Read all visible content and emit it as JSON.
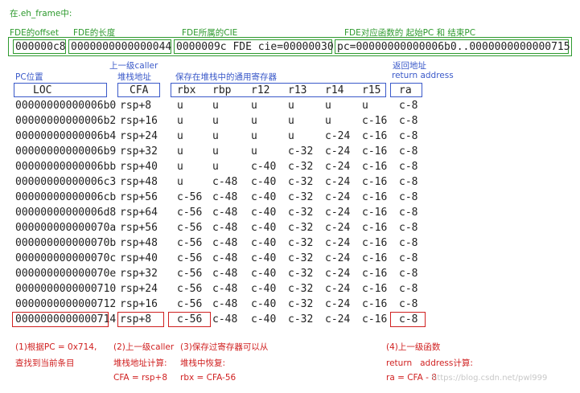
{
  "top": {
    "title": "在.eh_frame中:",
    "fde_labels": [
      "FDE的offset",
      "FDE的长度",
      "FDE所属的CIE",
      "FDE对应函数的 起始PC 和 结束PC"
    ],
    "fde_values": [
      "000000c8",
      "0000000000000044",
      "0000009c FDE cie=00000030",
      "pc=00000000000006b0..0000000000000715"
    ]
  },
  "headers": {
    "pc": "PC位置",
    "caller_1": "上一级caller",
    "caller_2": "堆栈地址",
    "saved": "保存在堆栈中的通用寄存器",
    "ret_1": "返回地址",
    "ret_2": "return address"
  },
  "columns": [
    "LOC",
    "CFA",
    "rbx",
    "rbp",
    "r12",
    "r13",
    "r14",
    "r15",
    "ra"
  ],
  "rows": [
    [
      "00000000000006b0",
      "rsp+8",
      "u",
      "u",
      "u",
      "u",
      "u",
      "u",
      "c-8"
    ],
    [
      "00000000000006b2",
      "rsp+16",
      "u",
      "u",
      "u",
      "u",
      "u",
      "c-16",
      "c-8"
    ],
    [
      "00000000000006b4",
      "rsp+24",
      "u",
      "u",
      "u",
      "u",
      "c-24",
      "c-16",
      "c-8"
    ],
    [
      "00000000000006b9",
      "rsp+32",
      "u",
      "u",
      "u",
      "c-32",
      "c-24",
      "c-16",
      "c-8"
    ],
    [
      "00000000000006bb",
      "rsp+40",
      "u",
      "u",
      "c-40",
      "c-32",
      "c-24",
      "c-16",
      "c-8"
    ],
    [
      "00000000000006c3",
      "rsp+48",
      "u",
      "c-48",
      "c-40",
      "c-32",
      "c-24",
      "c-16",
      "c-8"
    ],
    [
      "00000000000006cb",
      "rsp+56",
      "c-56",
      "c-48",
      "c-40",
      "c-32",
      "c-24",
      "c-16",
      "c-8"
    ],
    [
      "00000000000006d8",
      "rsp+64",
      "c-56",
      "c-48",
      "c-40",
      "c-32",
      "c-24",
      "c-16",
      "c-8"
    ],
    [
      "000000000000070a",
      "rsp+56",
      "c-56",
      "c-48",
      "c-40",
      "c-32",
      "c-24",
      "c-16",
      "c-8"
    ],
    [
      "000000000000070b",
      "rsp+48",
      "c-56",
      "c-48",
      "c-40",
      "c-32",
      "c-24",
      "c-16",
      "c-8"
    ],
    [
      "000000000000070c",
      "rsp+40",
      "c-56",
      "c-48",
      "c-40",
      "c-32",
      "c-24",
      "c-16",
      "c-8"
    ],
    [
      "000000000000070e",
      "rsp+32",
      "c-56",
      "c-48",
      "c-40",
      "c-32",
      "c-24",
      "c-16",
      "c-8"
    ],
    [
      "0000000000000710",
      "rsp+24",
      "c-56",
      "c-48",
      "c-40",
      "c-32",
      "c-24",
      "c-16",
      "c-8"
    ],
    [
      "0000000000000712",
      "rsp+16",
      "c-56",
      "c-48",
      "c-40",
      "c-32",
      "c-24",
      "c-16",
      "c-8"
    ],
    [
      "0000000000000714",
      "rsp+8",
      "c-56",
      "c-48",
      "c-40",
      "c-32",
      "c-24",
      "c-16",
      "c-8"
    ]
  ],
  "notes": {
    "n1": [
      "(1)根据PC = 0x714,",
      "查找到当前条目"
    ],
    "n2": [
      "(2)上一级caller",
      "堆栈地址计算:",
      "CFA = rsp+8"
    ],
    "n3": [
      "(3)保存过寄存器可以从",
      "堆栈中恢复:",
      "rbx = CFA-56"
    ],
    "n4": [
      "(4)上一级函数",
      "return   address计算:",
      "ra = CFA - 8"
    ]
  },
  "watermark": "https://blog.csdn.net/pwl999",
  "colors": {
    "green": "#2e9a2e",
    "blue": "#3a59c9",
    "red": "#d02020"
  }
}
